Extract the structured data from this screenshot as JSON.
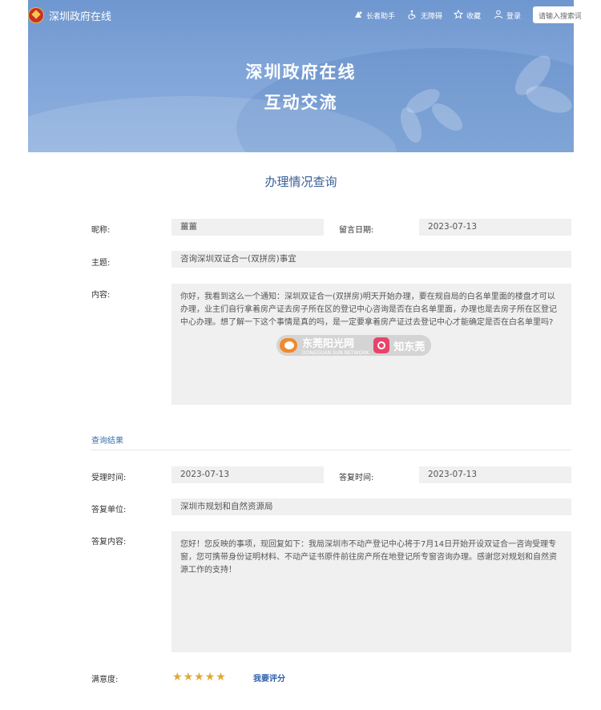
{
  "header": {
    "site_name": "深圳政府在线",
    "nav": [
      {
        "icon": "elder-icon",
        "label": "长者助手"
      },
      {
        "icon": "accessibility-icon",
        "label": "无障碍"
      },
      {
        "icon": "star-outline-icon",
        "label": "收藏"
      },
      {
        "icon": "user-icon",
        "label": "登录"
      }
    ],
    "search_placeholder": "请输入搜索词"
  },
  "banner": {
    "line1": "深圳政府在线",
    "line2": "互动交流"
  },
  "page_title": "办理情况查询",
  "inquiry": {
    "nickname_label": "昵称:",
    "nickname": "薑薑",
    "date_label": "留言日期:",
    "date": "2023-07-13",
    "subject_label": "主题:",
    "subject": "咨询深圳双证合一(双拼房)事宜",
    "content_label": "内容:",
    "content": "你好，我看到这么一个通知：深圳双证合一(双拼房)明天开始办理，要在规自局的白名单里面的楼盘才可以办理，业主们自行拿着房产证去房子所在区的登记中心咨询是否在白名单里面，办理也是去房子所在区登记中心办理。想了解一下这个事情是真的吗，是一定要拿着房产证过去登记中心才能确定是否在白名单里吗?"
  },
  "result": {
    "section_title": "查询结果",
    "accept_time_label": "受理时间:",
    "accept_time": "2023-07-13",
    "reply_time_label": "答复时间:",
    "reply_time": "2023-07-13",
    "reply_unit_label": "答复单位:",
    "reply_unit": "深圳市规划和自然资源局",
    "reply_content_label": "答复内容:",
    "reply_content": "您好！您反映的事项，现回复如下：我局深圳市不动产登记中心将于7月14日开始开设双证合一咨询受理专窗，您可携带身份证明材料、不动产证书原件前往房产所在地登记所专窗咨询办理。感谢您对规划和自然资源工作的支持！",
    "satisfaction_label": "满意度:",
    "rating": 5,
    "rate_link": "我要评分"
  },
  "watermark": {
    "text1": "东莞阳光网",
    "text1_sub": "DONGGUAN SUN NETWORK",
    "text2": "知东莞"
  },
  "colors": {
    "banner": "#7ea3d7",
    "title": "#3a5f96",
    "link": "#2f5fa8",
    "star": "#e0a83a",
    "field_bg": "#f0f0f0"
  }
}
